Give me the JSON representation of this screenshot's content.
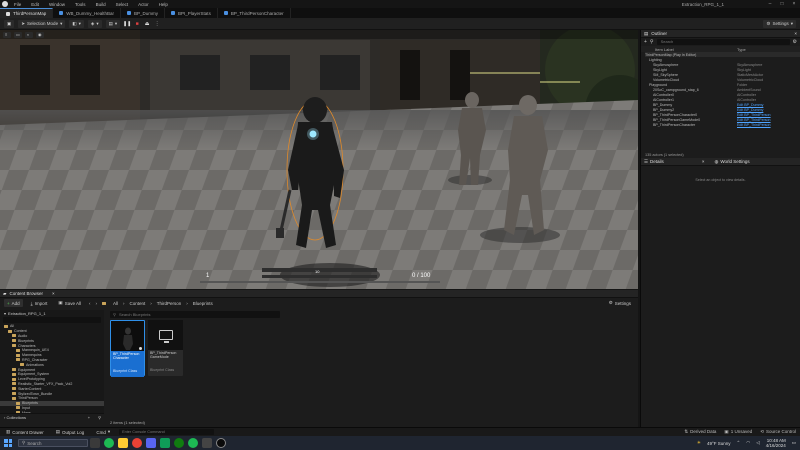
{
  "menu": {
    "items": [
      "File",
      "Edit",
      "Window",
      "Tools",
      "Build",
      "Select",
      "Actor",
      "Help"
    ],
    "project": "Extraction_RPG_1_1"
  },
  "tabs": [
    {
      "label": "ThirdPersonMap",
      "color": "#e8e8e8"
    },
    {
      "label": "WB_Dummy_HealthBar",
      "color": "#4a90e2"
    },
    {
      "label": "BP_Dummy",
      "color": "#4a90e2"
    },
    {
      "label": "BPI_PlayerStats",
      "color": "#4a90e2"
    },
    {
      "label": "BP_ThirdPersonCharacter",
      "color": "#4a90e2"
    }
  ],
  "toolbar": {
    "mode": "Selection Mode",
    "settings": "Settings"
  },
  "viewport": {
    "hud_left": "1",
    "hud_center": "10",
    "hud_right": "0 / 100"
  },
  "outliner": {
    "title": "Outliner",
    "search_placeholder": "Search",
    "col_label": "Item Label",
    "col_type": "Type",
    "rows": [
      {
        "name": "ThirdPersonMap (Play In Editor)",
        "type": "",
        "link": false
      },
      {
        "name": "Lighting",
        "type": "",
        "link": false
      },
      {
        "name": "SkyAtmosphere",
        "type": "SkyAtmosphere",
        "link": false
      },
      {
        "name": "SkyLight",
        "type": "SkyLight",
        "link": false
      },
      {
        "name": "SM_SkySphere",
        "type": "StaticMeshActor",
        "link": false
      },
      {
        "name": "VolumetricCloud",
        "type": "VolumetricCloud",
        "link": false
      },
      {
        "name": "Playground",
        "type": "Folder",
        "link": false
      },
      {
        "name": "20SoC_campground_stap_6",
        "type": "AmbientSound",
        "link": false
      },
      {
        "name": "AIController0",
        "type": "AIController",
        "link": false
      },
      {
        "name": "AIController1",
        "type": "AIController",
        "link": false
      },
      {
        "name": "BP_Dummy",
        "type": "Edit BP_Dummy",
        "link": true
      },
      {
        "name": "BP_Dummy2",
        "type": "Edit BP_Dummy",
        "link": true
      },
      {
        "name": "BP_ThirdPersonCharacter0",
        "type": "Edit BP_ThirdPerson",
        "link": true
      },
      {
        "name": "BP_ThirdPersonGameMode0",
        "type": "Edit BP_ThirdPerson",
        "link": true
      },
      {
        "name": "BP_ThirdPersonCharacter",
        "type": "Edit BP_ThirdPerson",
        "link": true
      }
    ],
    "footer": "135 actors (1 selected)"
  },
  "details": {
    "tab1": "Details",
    "tab2": "World Settings",
    "empty": "Select an object to view details."
  },
  "content_browser": {
    "title": "Content Browser",
    "add": "Add",
    "import": "Import",
    "save_all": "Save All",
    "all": "All",
    "path": [
      "Content",
      "ThirdPerson",
      "Blueprints"
    ],
    "settings": "Settings",
    "project": "Extraction_RPG_1_1",
    "search_placeholder": "Search Blueprints",
    "tree": [
      "All",
      "Content",
      "Audio",
      "Blueprints",
      "Characters",
      "Mannequin_UE4",
      "Mannequins",
      "RPG_Character",
      "Animations",
      "Equipment",
      "Equipment_System",
      "LevelPrototyping",
      "Realistic_Starter_VFX_Pack_Vol2",
      "StarterContent",
      "StylizedTown_Bundle",
      "ThirdPerson",
      "Blueprints",
      "Input",
      "Maps"
    ],
    "collections": "Collections",
    "assets": [
      {
        "name": "BP_ThirdPerson Character",
        "type": "Blueprint Class"
      },
      {
        "name": "BP_ThirdPerson GameMode",
        "type": "Blueprint Class"
      }
    ],
    "count": "2 items (1 selected)",
    "filter_icon": "filter-icon"
  },
  "status": {
    "content_drawer": "Content Drawer",
    "output_log": "Output Log",
    "cmd": "Cmd",
    "cmd_placeholder": "Enter Console Command",
    "derived": "Derived Data",
    "unsaved": "1 Unsaved",
    "source": "Source Control"
  },
  "taskbar": {
    "search": "Search",
    "weather": "49°F Sunny",
    "time": "10:48 AM",
    "date": "4/16/2024"
  }
}
